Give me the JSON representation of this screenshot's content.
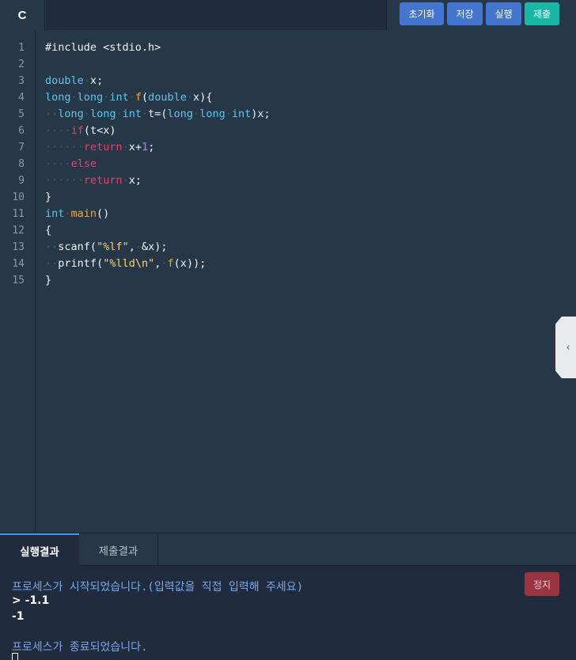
{
  "language_tab": "C",
  "toolbar": {
    "reset_label": "초기화",
    "save_label": "저장",
    "run_label": "실행",
    "submit_label": "제출"
  },
  "editor": {
    "line_numbers": [
      "1",
      "2",
      "3",
      "4",
      "5",
      "6",
      "7",
      "8",
      "9",
      "10",
      "11",
      "12",
      "13",
      "14",
      "15"
    ],
    "code_lines": [
      "#include <stdio.h>",
      "",
      "double x;",
      "long long int f(double x){",
      "  long long int t=(long long int)x;",
      "    if(t<x)",
      "      return x+1;",
      "    else",
      "      return x;",
      "}",
      "int main()",
      "{",
      "  scanf(\"%lf\", &x);",
      "  printf(\"%lld\\n\", f(x));",
      "}"
    ]
  },
  "side_handle_icon": "chevron-left-icon",
  "output": {
    "tabs": [
      "실행결과",
      "제출결과"
    ],
    "stop_label": "정지",
    "lines": [
      "프로세스가 시작되었습니다.(입력값을 직접 입력해 주세요)",
      "> -1.1",
      "-1",
      "",
      "프로세스가 종료되었습니다."
    ]
  },
  "colors": {
    "background": "#263747",
    "console_background": "#202b3d",
    "button_blue": "#4576cf",
    "button_teal": "#18b8a4",
    "stop_red": "#9b3441",
    "keyword": "#ef3e6b",
    "type": "#5cc8ef",
    "function": "#f9a825",
    "string": "#f7d37a",
    "number": "#b77ef2"
  }
}
